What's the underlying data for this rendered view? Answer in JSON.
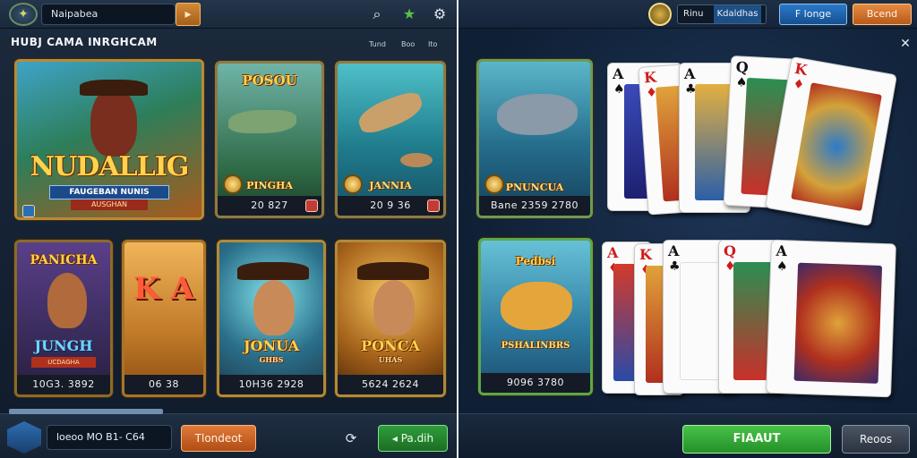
{
  "header": {
    "search_value": "Naipabea",
    "icons": [
      "search-icon",
      "star-icon",
      "gear-icon"
    ]
  },
  "lobby": {
    "section_title": "HUBJ CAMA INRGHCAM",
    "filters": [
      "Tund",
      "Boo",
      "Ito"
    ],
    "games": [
      {
        "title": "NUDALLIG",
        "subtitle": "FAUGEBAN NUNIS",
        "tag": "AUSGHAN",
        "footer": ""
      },
      {
        "title": "POSOU",
        "subtitle": "PINGHA",
        "footer": "20 827"
      },
      {
        "title": "",
        "subtitle": "JANNIA",
        "footer": "20 9 36"
      },
      {
        "title": "PANICHA",
        "subtitle": "JUNGH",
        "tag": "UCDAGHA",
        "footer": "10G3. 3892"
      },
      {
        "title": "K A",
        "subtitle": "",
        "footer": "06 38"
      },
      {
        "title": "",
        "subtitle": "JONUA",
        "tag": "GHBS",
        "footer": "10H36 2928"
      },
      {
        "title": "",
        "subtitle": "PONCA",
        "tag": "UHAS",
        "footer": "5624 2624"
      }
    ]
  },
  "bottom_left": {
    "field_value": "loeoo MO B1- C64",
    "action_label": "Tlondeot",
    "confirm_label": "Pa.dih"
  },
  "right_header": {
    "player_name": "Rinu",
    "player_tag": "Kdaldhas",
    "blue_button": "F longe",
    "orange_button": "Bcend"
  },
  "fish_cards": [
    {
      "subtitle": "PNUNCUA",
      "footer": "Bane 2359 2780"
    },
    {
      "title": "Pedbsi",
      "subtitle": "PSHALINBRS",
      "footer": "9096 3780"
    }
  ],
  "top_hand": [
    {
      "rank": "A",
      "suit": "♠",
      "color": "black"
    },
    {
      "rank": "K",
      "suit": "♦",
      "color": "red"
    },
    {
      "rank": "A",
      "suit": "♣",
      "color": "black"
    },
    {
      "rank": "Q",
      "suit": "♠",
      "color": "black"
    },
    {
      "rank": "K",
      "suit": "♦",
      "color": "red"
    }
  ],
  "bottom_hand": [
    {
      "rank": "A",
      "suit": "♦",
      "color": "red"
    },
    {
      "rank": "K",
      "suit": "♦",
      "color": "red"
    },
    {
      "rank": "A",
      "suit": "♣",
      "color": "black"
    },
    {
      "rank": "Q",
      "suit": "♦",
      "color": "red"
    },
    {
      "rank": "A",
      "suit": "♠",
      "color": "black"
    }
  ],
  "bottom_right": {
    "primary_label": "FIAAUT",
    "secondary_label": "Reoos"
  },
  "colors": {
    "gold_frame": "#b88a38",
    "accent_green": "#239028",
    "accent_orange": "#b04d15",
    "accent_blue": "#16508f"
  }
}
